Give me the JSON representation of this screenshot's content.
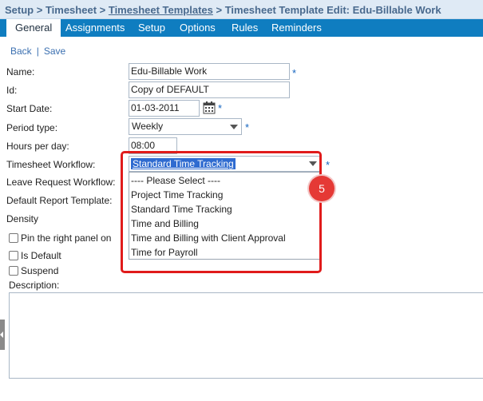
{
  "breadcrumb": {
    "setup": "Setup",
    "sep1": " > ",
    "timesheet": "Timesheet",
    "sep2": " > ",
    "templates": "Timesheet Templates",
    "sep3": " > ",
    "current": "Timesheet Template Edit: Edu-Billable Work"
  },
  "tabs": [
    "General",
    "Assignments",
    "Setup",
    "Options",
    "Rules",
    "Reminders"
  ],
  "actions": {
    "back": "Back",
    "separator": "|",
    "save": "Save"
  },
  "form": {
    "name_label": "Name:",
    "name_value": "Edu-Billable Work",
    "id_label": "Id:",
    "id_value": "Copy of DEFAULT",
    "start_date_label": "Start Date:",
    "start_date_value": "01-03-2011",
    "period_type_label": "Period type:",
    "period_type_value": "Weekly",
    "hours_label": "Hours per day:",
    "hours_value": "08:00",
    "workflow_label": "Timesheet Workflow:",
    "leave_label": "Leave Request Workflow:",
    "report_label": "Default Report Template:",
    "density_label": "Density",
    "pin_label": "Pin the right panel on",
    "is_default_label": "Is Default",
    "suspend_label": "Suspend",
    "description_label": "Description:",
    "required_mark": "*"
  },
  "workflow_dropdown": {
    "selected": "Standard Time Tracking",
    "options": [
      "---- Please Select ----",
      "Project Time Tracking",
      "Standard Time Tracking",
      "Time and Billing",
      "Time and Billing with Client Approval",
      "Time for Payroll"
    ]
  },
  "step_badge": "5",
  "colors": {
    "tab_bar": "#0f7dc0",
    "highlight": "#e01b1b",
    "selection": "#2f6bd0",
    "required": "#1565c0"
  }
}
